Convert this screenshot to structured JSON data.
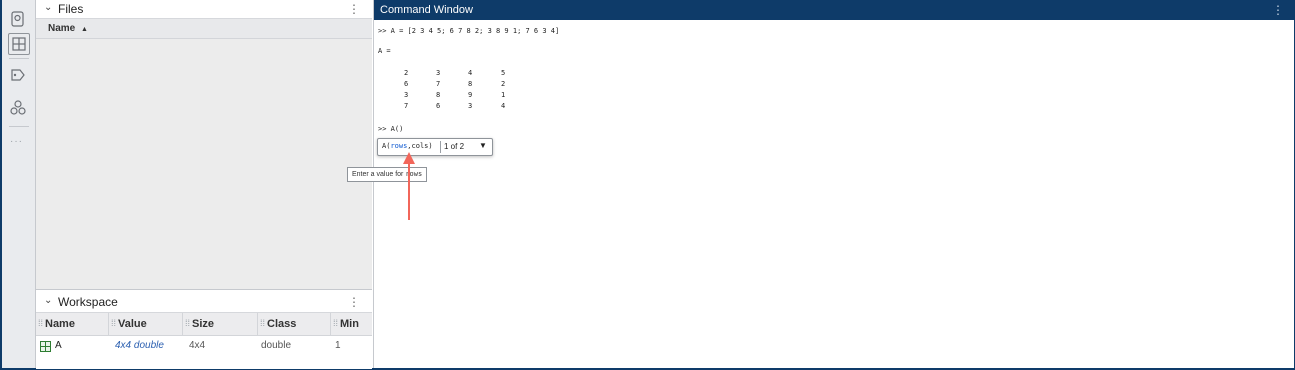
{
  "icons": {
    "toolstrip": [
      "files-search-icon",
      "grid-icon",
      "tag-icon",
      "apps-icon",
      "more-icon"
    ]
  },
  "files_panel": {
    "title": "Files",
    "column_name": "Name",
    "sort_indicator": "▲"
  },
  "workspace": {
    "title": "Workspace",
    "columns": [
      "Name",
      "Value",
      "Size",
      "Class",
      "Min"
    ],
    "rows": [
      {
        "name": "A",
        "value": "4x4 double",
        "size": "4x4",
        "class": "double",
        "min": "1"
      }
    ]
  },
  "command_window": {
    "title": "Command Window",
    "line1": ">> A = [2 3 4 5; 6 7 8 2; 3 8 9 1; 7 6 3 4]",
    "output_label": "A =",
    "matrix": [
      [
        "2",
        "3",
        "4",
        "5"
      ],
      [
        "6",
        "7",
        "8",
        "2"
      ],
      [
        "3",
        "8",
        "9",
        "1"
      ],
      [
        "7",
        "6",
        "3",
        "4"
      ]
    ],
    "line2": ">> A()",
    "tooltip": {
      "fn": "A(",
      "arg": "rows",
      "rest": ",cols)",
      "count": "1 of 2",
      "hint_prefix": "Enter a value for",
      "hint_arg": "rows"
    }
  },
  "colors": {
    "title_bar": "#0e3b69",
    "accent_link": "#2b5fb0",
    "arrow": "#f2665a"
  }
}
